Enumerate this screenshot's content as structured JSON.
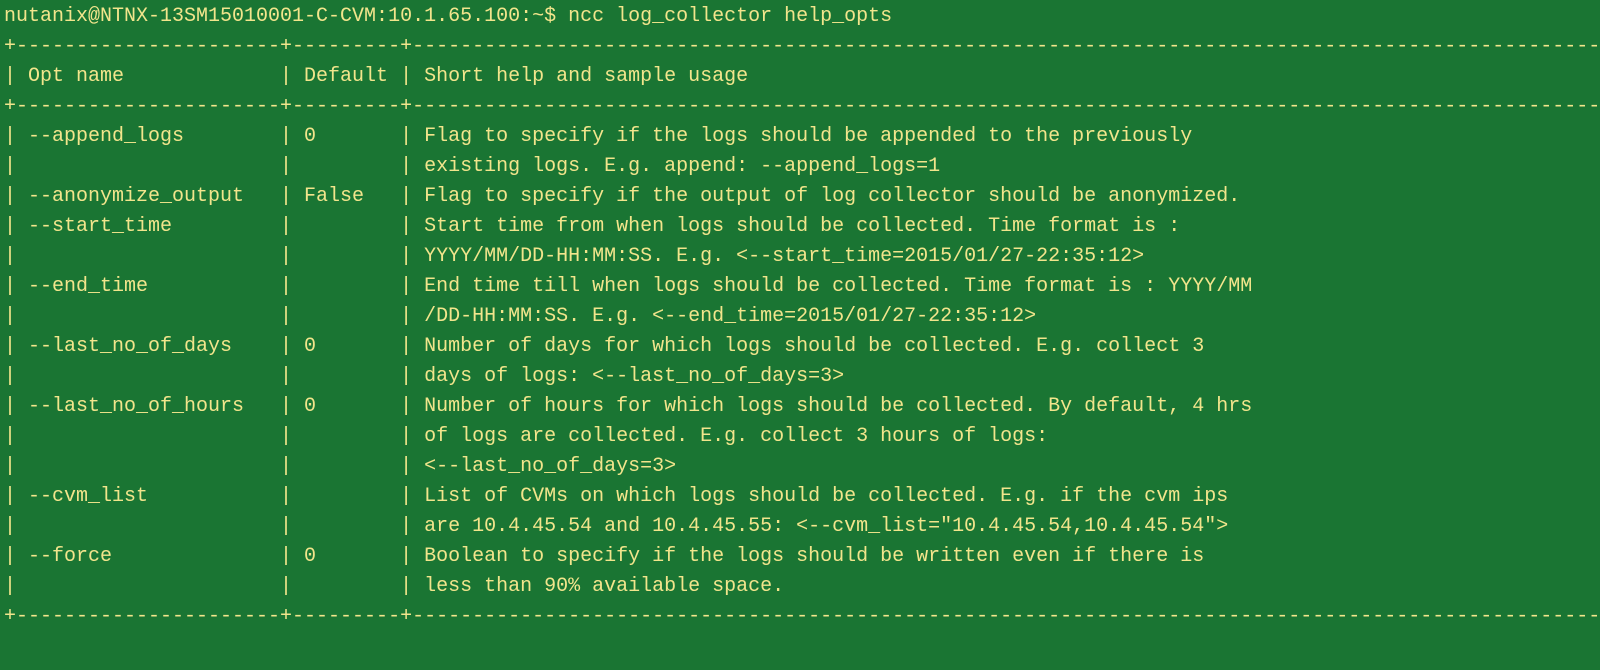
{
  "prompt": {
    "user_host": "nutanix@NTNX-13SM15010001-C-CVM:10.1.65.100:~$",
    "command": "ncc log_collector help_opts"
  },
  "table": {
    "border_top": "+----------------------+---------+-----------------------------------------------------------------------------------------------------+",
    "border_mid": "+----------------------+---------+-----------------------------------------------------------------------------------------------------+",
    "border_bottom": "+----------------------+---------+-----------------------------------------------------------------------------------------------------+",
    "columns": {
      "col1_header": "Opt name",
      "col2_header": "Default",
      "col3_header": "Short help and sample usage"
    },
    "col_widths": {
      "c1": 20,
      "c2": 7,
      "c3": 99
    },
    "rows": [
      {
        "opt": "--append_logs",
        "default": "0",
        "help": [
          "Flag to specify if the logs should be appended to the previously",
          "existing logs. E.g. append: --append_logs=1"
        ]
      },
      {
        "opt": "--anonymize_output",
        "default": "False",
        "help": [
          "Flag to specify if the output of log collector should be anonymized."
        ]
      },
      {
        "opt": "--start_time",
        "default": "",
        "help": [
          "Start time from when logs should be collected. Time format is :",
          "YYYY/MM/DD-HH:MM:SS. E.g. <--start_time=2015/01/27-22:35:12>"
        ]
      },
      {
        "opt": "--end_time",
        "default": "",
        "help": [
          "End time till when logs should be collected. Time format is : YYYY/MM",
          "/DD-HH:MM:SS. E.g. <--end_time=2015/01/27-22:35:12>"
        ]
      },
      {
        "opt": "--last_no_of_days",
        "default": "0",
        "help": [
          "Number of days for which logs should be collected. E.g. collect 3",
          "days of logs: <--last_no_of_days=3>"
        ]
      },
      {
        "opt": "--last_no_of_hours",
        "default": "0",
        "help": [
          "Number of hours for which logs should be collected. By default, 4 hrs",
          "of logs are collected. E.g. collect 3 hours of logs:",
          "<--last_no_of_days=3>"
        ]
      },
      {
        "opt": "--cvm_list",
        "default": "",
        "help": [
          "List of CVMs on which logs should be collected. E.g. if the cvm ips",
          "are 10.4.45.54 and 10.4.45.55: <--cvm_list=\"10.4.45.54,10.4.45.54\">"
        ]
      },
      {
        "opt": "--force",
        "default": "0",
        "help": [
          "Boolean to specify if the logs should be written even if there is",
          "less than 90% available space."
        ]
      }
    ]
  }
}
